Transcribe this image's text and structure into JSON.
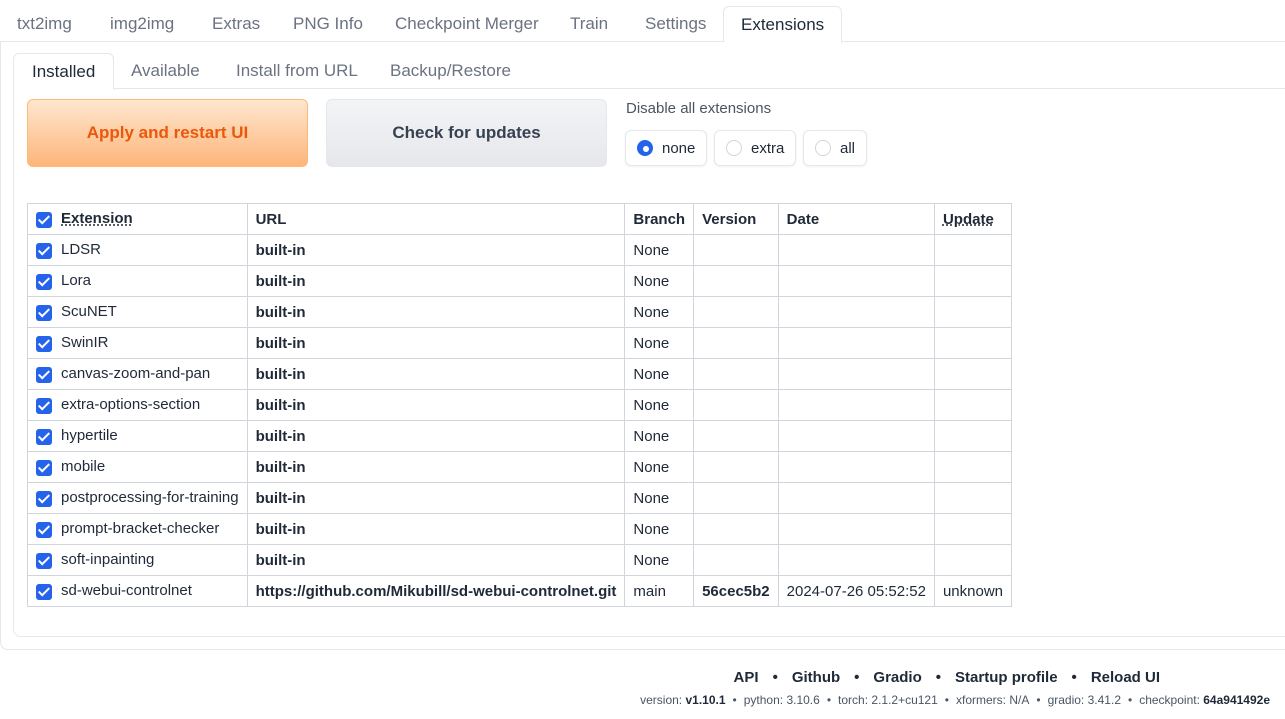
{
  "top_tabs": [
    "txt2img",
    "img2img",
    "Extras",
    "PNG Info",
    "Checkpoint Merger",
    "Train",
    "Settings",
    "Extensions"
  ],
  "sub_tabs": [
    "Installed",
    "Available",
    "Install from URL",
    "Backup/Restore"
  ],
  "buttons": {
    "apply": "Apply and restart UI",
    "check": "Check for updates"
  },
  "disable": {
    "label": "Disable all extensions",
    "options": [
      "none",
      "extra",
      "all"
    ],
    "selected": "none"
  },
  "table": {
    "headers": [
      "Extension",
      "URL",
      "Branch",
      "Version",
      "Date",
      "Update"
    ],
    "rows": [
      {
        "name": "LDSR",
        "url": "built-in",
        "branch": "None",
        "version": "",
        "date": "",
        "update": ""
      },
      {
        "name": "Lora",
        "url": "built-in",
        "branch": "None",
        "version": "",
        "date": "",
        "update": ""
      },
      {
        "name": "ScuNET",
        "url": "built-in",
        "branch": "None",
        "version": "",
        "date": "",
        "update": ""
      },
      {
        "name": "SwinIR",
        "url": "built-in",
        "branch": "None",
        "version": "",
        "date": "",
        "update": ""
      },
      {
        "name": "canvas-zoom-and-pan",
        "url": "built-in",
        "branch": "None",
        "version": "",
        "date": "",
        "update": ""
      },
      {
        "name": "extra-options-section",
        "url": "built-in",
        "branch": "None",
        "version": "",
        "date": "",
        "update": ""
      },
      {
        "name": "hypertile",
        "url": "built-in",
        "branch": "None",
        "version": "",
        "date": "",
        "update": ""
      },
      {
        "name": "mobile",
        "url": "built-in",
        "branch": "None",
        "version": "",
        "date": "",
        "update": ""
      },
      {
        "name": "postprocessing-for-training",
        "url": "built-in",
        "branch": "None",
        "version": "",
        "date": "",
        "update": ""
      },
      {
        "name": "prompt-bracket-checker",
        "url": "built-in",
        "branch": "None",
        "version": "",
        "date": "",
        "update": ""
      },
      {
        "name": "soft-inpainting",
        "url": "built-in",
        "branch": "None",
        "version": "",
        "date": "",
        "update": ""
      },
      {
        "name": "sd-webui-controlnet",
        "url": "https://github.com/Mikubill/sd-webui-controlnet.git",
        "branch": "main",
        "version": "56cec5b2",
        "date": "2024-07-26 05:52:52",
        "update": "unknown"
      }
    ]
  },
  "footer": {
    "links": [
      "API",
      "Github",
      "Gradio",
      "Startup profile",
      "Reload UI"
    ],
    "version_label": "version:",
    "version": "v1.10.1",
    "python_label": "python:",
    "python": "3.10.6",
    "torch_label": "torch:",
    "torch": "2.1.2+cu121",
    "xformers_label": "xformers:",
    "xformers": "N/A",
    "gradio_label": "gradio:",
    "gradio": "3.41.2",
    "checkpoint_label": "checkpoint:",
    "checkpoint": "64a941492e"
  },
  "colors": {
    "accent": "#2563eb",
    "primary_text": "#ea580c"
  }
}
